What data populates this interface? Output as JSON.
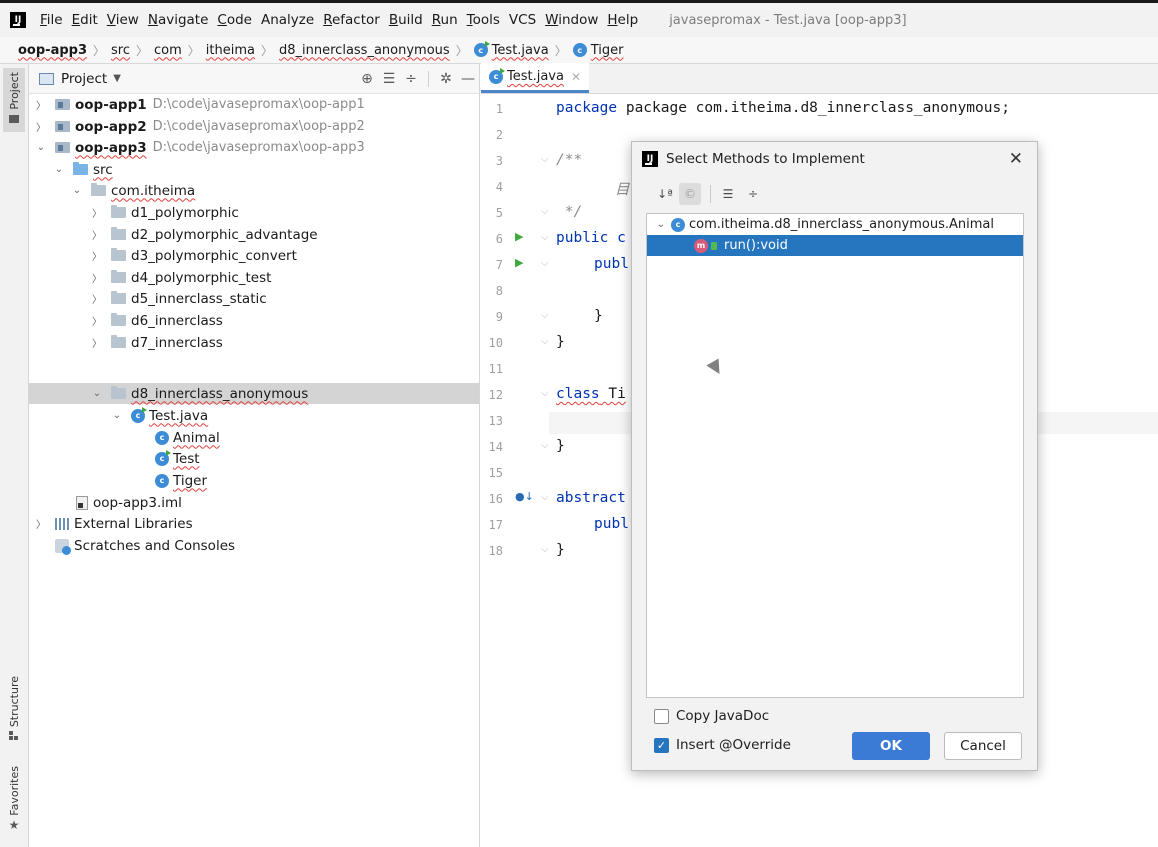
{
  "menu": {
    "items": [
      {
        "mn": "F",
        "rest": "ile"
      },
      {
        "mn": "E",
        "rest": "dit"
      },
      {
        "mn": "V",
        "rest": "iew"
      },
      {
        "mn": "N",
        "rest": "avigate"
      },
      {
        "mn": "C",
        "rest": "ode"
      },
      {
        "mn": "",
        "rest": "Analyze"
      },
      {
        "mn": "R",
        "rest": "efactor"
      },
      {
        "mn": "B",
        "rest": "uild"
      },
      {
        "mn": "R",
        "rest": "un"
      },
      {
        "mn": "T",
        "rest": "ools"
      },
      {
        "mn": "",
        "rest": "VCS"
      },
      {
        "mn": "W",
        "rest": "indow"
      },
      {
        "mn": "H",
        "rest": "elp"
      }
    ],
    "window_title": "javasepromax - Test.java [oop-app3]"
  },
  "breadcrumb": [
    "oop-app3",
    "src",
    "com",
    "itheima",
    "d8_innerclass_anonymous",
    "Test.java",
    "Tiger"
  ],
  "stripe": {
    "project": "Project",
    "structure": "Structure",
    "favorites": "Favorites"
  },
  "project": {
    "title": "Project",
    "tree": [
      {
        "label": "oop-app1",
        "path": "D:\\code\\javasepromax\\oop-app1"
      },
      {
        "label": "oop-app2",
        "path": "D:\\code\\javasepromax\\oop-app2"
      },
      {
        "label": "oop-app3",
        "path": "D:\\code\\javasepromax\\oop-app3"
      },
      {
        "label": "src"
      },
      {
        "label": "com.itheima"
      },
      {
        "label": "d1_polymorphic"
      },
      {
        "label": "d2_polymorphic_advantage"
      },
      {
        "label": "d3_polymorphic_convert"
      },
      {
        "label": "d4_polymorphic_test"
      },
      {
        "label": "d5_innerclass_static"
      },
      {
        "label": "d6_innerclass"
      },
      {
        "label": "d7_innerclass"
      },
      {
        "label": "d8_innerclass_anonymous"
      },
      {
        "label": "Test.java"
      },
      {
        "label": "Animal"
      },
      {
        "label": "Test"
      },
      {
        "label": "Tiger"
      },
      {
        "label": "oop-app3.iml"
      },
      {
        "label": "External Libraries"
      },
      {
        "label": "Scratches and Consoles"
      }
    ]
  },
  "editor": {
    "tab": "Test.java",
    "lines": {
      "l1": "package com.itheima.d8_innerclass_anonymous;",
      "l3": "/**",
      "l4": "目",
      "l5": " */",
      "l6a": "public",
      "l6b": " c",
      "l7": "publ",
      "l9": "}",
      "l10": "}",
      "l12": "class",
      "l12b": " Ti",
      "l14": "}",
      "l16": "abstract",
      "l17": "publ",
      "l18": "}"
    },
    "line_numbers": [
      "1",
      "2",
      "3",
      "4",
      "5",
      "6",
      "7",
      "8",
      "9",
      "10",
      "11",
      "12",
      "13",
      "14",
      "15",
      "16",
      "17",
      "18"
    ]
  },
  "dialog": {
    "title": "Select Methods to Implement",
    "class_node": "com.itheima.d8_innerclass_anonymous.Animal",
    "method": "run():void",
    "copy_javadoc": "Copy JavaDoc",
    "insert_override": "Insert @Override",
    "ok": "OK",
    "cancel": "Cancel"
  }
}
